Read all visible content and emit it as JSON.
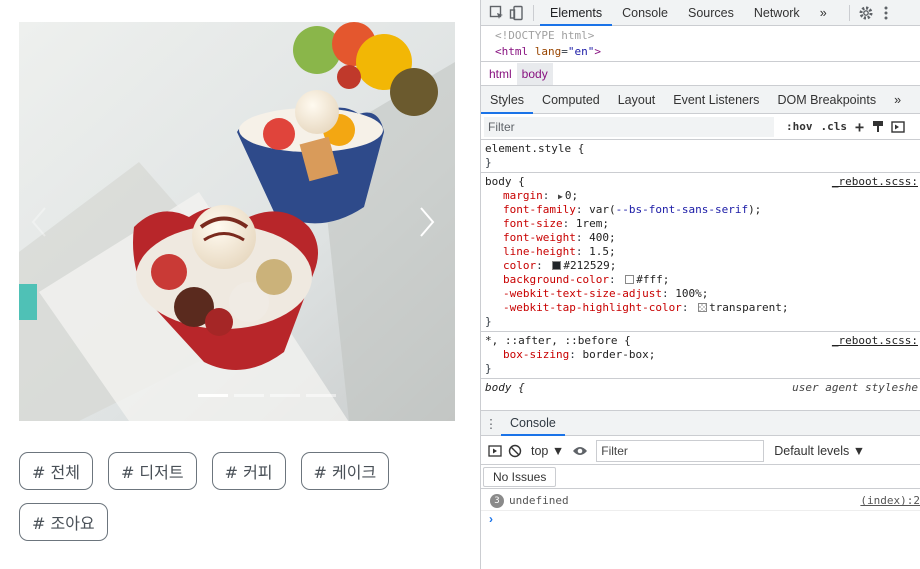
{
  "carousel": {
    "next_icon": "chevron-right-icon",
    "prev_icon": "chevron-left-icon",
    "indicator_count": 4,
    "active_indicator": 1
  },
  "tags": [
    {
      "label": "# 전체"
    },
    {
      "label": "# 디저트"
    },
    {
      "label": "# 커피"
    },
    {
      "label": "# 케이크"
    },
    {
      "label": "# 조아요"
    }
  ],
  "devtools": {
    "main_tabs": [
      "Elements",
      "Console",
      "Sources",
      "Network"
    ],
    "more_tabs": "»",
    "dom": {
      "doctype": "<!DOCTYPE html>",
      "html_open": "<html",
      "attr_name": "lang",
      "attr_value": "\"en\"",
      "html_close": ">"
    },
    "breadcrumbs": [
      "html",
      "body"
    ],
    "sub_tabs": [
      "Styles",
      "Computed",
      "Layout",
      "Event Listeners",
      "DOM Breakpoints"
    ],
    "filter_placeholder": "Filter",
    "hov": ":hov",
    "cls": ".cls",
    "plus": "+",
    "rules": {
      "element_style": {
        "selector": "element.style {",
        "close": "}"
      },
      "body": {
        "selector": "body {",
        "source": "_reboot.scss:",
        "margin_prop": "margin",
        "margin_val": "0;",
        "ff_prop": "font-family",
        "ff_val_a": "var(",
        "ff_var": "--bs-font-sans-serif",
        "ff_val_b": ");",
        "fs_prop": "font-size",
        "fs_val": "1rem;",
        "fw_prop": "font-weight",
        "fw_val": "400;",
        "lh_prop": "line-height",
        "lh_val": "1.5;",
        "color_prop": "color",
        "color_val": "#212529;",
        "color_hex": "#212529",
        "bg_prop": "background-color",
        "bg_val": "#fff;",
        "bg_hex": "#ffffff",
        "ts_prop": "-webkit-text-size-adjust",
        "ts_val": "100%;",
        "th_prop": "-webkit-tap-highlight-color",
        "th_val": "transparent;",
        "close": "}"
      },
      "universal": {
        "selector": "*, ::after, ::before {",
        "source": "_reboot.scss:",
        "bs_prop": "box-sizing",
        "bs_val": "border-box;",
        "close": "}"
      },
      "ua": {
        "selector": "body {",
        "source": "user agent styleshe"
      }
    },
    "drawer_tab": "Console",
    "console": {
      "context": "top ▼",
      "filter_placeholder": "Filter",
      "levels": "Default levels ▼",
      "issues": "No Issues",
      "log_count": "3",
      "log_text": "undefined",
      "log_source": "(index):2",
      "prompt": "›"
    }
  }
}
